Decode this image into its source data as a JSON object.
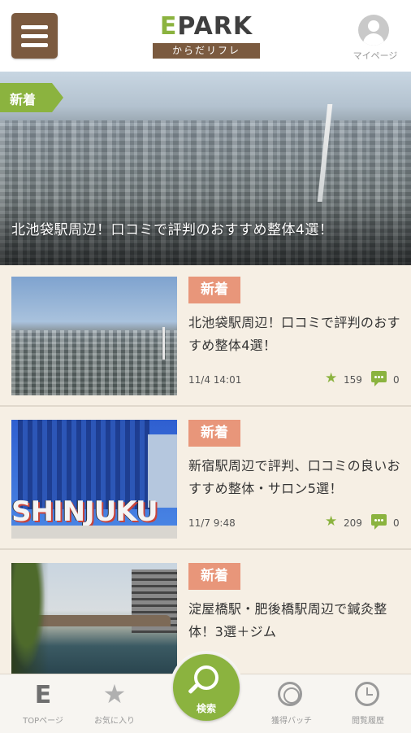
{
  "header": {
    "logo_main": "EPARK",
    "logo_e": "E",
    "logo_rest": "PARK",
    "logo_sub": "からだリフレ",
    "mypage_label": "マイページ"
  },
  "hero": {
    "badge": "新着",
    "title": "北池袋駅周辺！口コミで評判のおすすめ整体4選！"
  },
  "articles": [
    {
      "badge": "新着",
      "title": "北池袋駅周辺！口コミで評判のおすすめ整体4選！",
      "date": "11/4  14:01",
      "favorites": "159",
      "comments": "0"
    },
    {
      "badge": "新着",
      "title": "新宿駅周辺で評判、口コミの良いおすすめ整体・サロン5選！",
      "date": "11/7  9:48",
      "favorites": "209",
      "comments": "0",
      "thumb_sign": "SHINJUKU"
    },
    {
      "badge": "新着",
      "title": "淀屋橋駅・肥後橋駅周辺で鍼灸整体！3選＋ジム"
    }
  ],
  "bottom_nav": {
    "top": "TOPページ",
    "favorites": "お気に入り",
    "search": "検索",
    "badges": "獲得バッチ",
    "history": "閲覧履歴"
  },
  "colors": {
    "brand_brown": "#7b5a3f",
    "brand_green": "#8bb33f",
    "new_badge": "#e8967a",
    "background": "#f6efe4"
  }
}
